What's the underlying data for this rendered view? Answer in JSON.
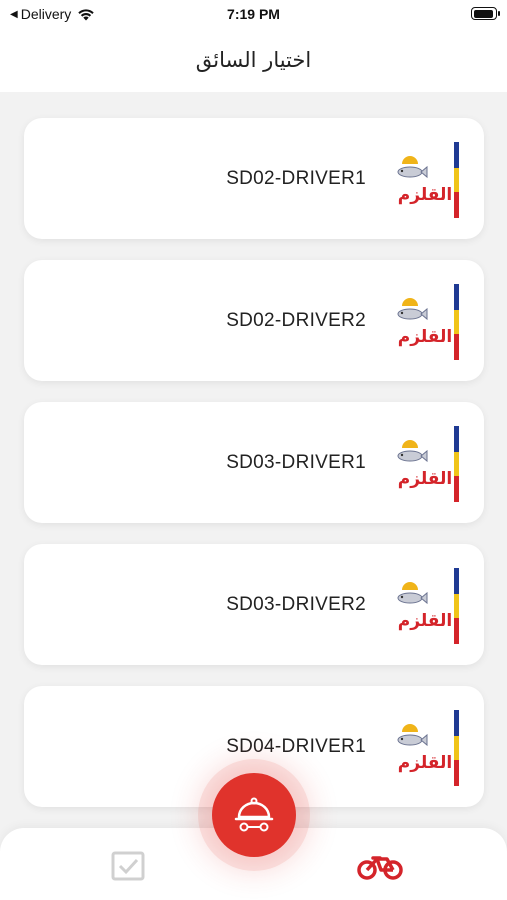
{
  "status_bar": {
    "back_label": "◀",
    "carrier": "Delivery",
    "time": "7:19 PM"
  },
  "header": {
    "title": "اختيار السائق"
  },
  "drivers": [
    {
      "name": "SD02-DRIVER1"
    },
    {
      "name": "SD02-DRIVER2"
    },
    {
      "name": "SD03-DRIVER1"
    },
    {
      "name": "SD03-DRIVER2"
    },
    {
      "name": "SD04-DRIVER1"
    }
  ],
  "logo": {
    "text": "القلزم"
  },
  "bottom_nav": {
    "left_icon": "checkbox-icon",
    "center_icon": "food-tray-icon",
    "right_icon": "bicycle-icon"
  },
  "colors": {
    "accent": "#e0332c",
    "logo_red": "#d4242a",
    "logo_yellow": "#f0c419",
    "logo_blue": "#1f3a93"
  }
}
